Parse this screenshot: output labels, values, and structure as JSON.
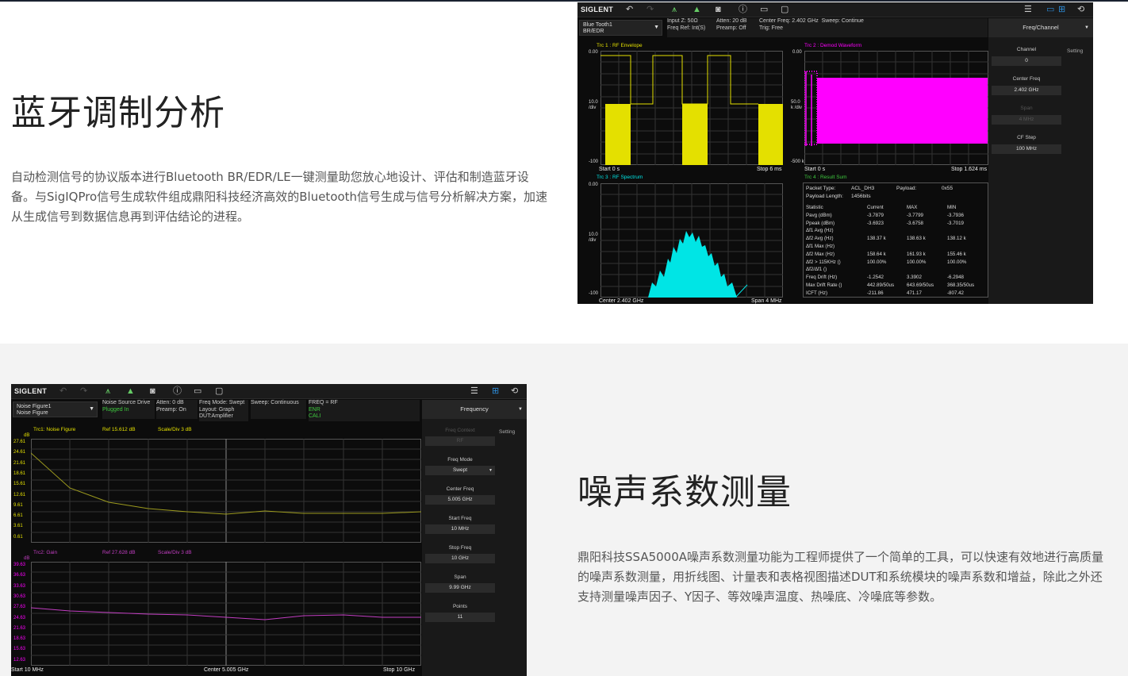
{
  "section1": {
    "title": "蓝牙调制分析",
    "description": "自动检测信号的协议版本进行Bluetooth BR/EDR/LE一键测量助您放心地设计、评估和制造蓝牙设备。与SigIQPro信号生成软件组成鼎阳科技经济高效的Bluetooth信号生成与信号分析解决方案，加速从生成信号到数据信息再到评估结论的进程。",
    "screenshot": {
      "brand": "SIGLENT",
      "mode_select": [
        "Blue Tooth1",
        "BR/EDR"
      ],
      "info": {
        "input_z": "Input Z: 50Ω",
        "freq_ref": "Freq Ref: Int(S)",
        "atten": "Atten: 20 dB",
        "preamp": "Preamp: Off",
        "center_freq": "Center Freq: 2.402 GHz",
        "sweep": "Sweep: Continue",
        "trig": "Trig: Free"
      },
      "panel": {
        "header": "Freq/Channel",
        "setting": "Setting",
        "items": [
          {
            "label": "Channel",
            "value": "0",
            "enabled": true
          },
          {
            "label": "Center Freq",
            "value": "2.402 GHz",
            "enabled": true
          },
          {
            "label": "Span",
            "value": "4 MHz",
            "enabled": false
          },
          {
            "label": "CF Step",
            "value": "100 MHz",
            "enabled": true
          }
        ]
      },
      "trace1": {
        "label": "Trc 1 :  RF Envelope",
        "ticks": [
          "0.00",
          "10.0 /div",
          "-100"
        ],
        "start": "Start 0 s",
        "stop": "Stop 6 ms"
      },
      "trace2": {
        "label": "Trc 2 :  Demod Waveform",
        "ticks": [
          "0.00",
          "50.0 k /div",
          "-500 k"
        ],
        "start": "Start 0 s",
        "stop": "Stop 1.624 ms"
      },
      "trace3": {
        "label": "Trc 3 :  RF Spectrum",
        "ticks": [
          "0.00",
          "10.0 /div",
          "-100"
        ],
        "start": "Center 2.402 GHz",
        "stop": "Span 4 MHz"
      },
      "trace4": {
        "label": "Trc 4 :  Result Sum",
        "packet_type_label": "Packet Type:",
        "packet_type": "ACL_DH3",
        "payload_label": "Payload:",
        "payload": "0x55",
        "payload_length_label": "Payload Length:",
        "payload_length": "1456bits",
        "columns": [
          "Statistic",
          "Current",
          "MAX",
          "MIN"
        ],
        "rows": [
          [
            "Pavg (dBm)",
            "-3.7879",
            "-3.7799",
            "-3.7936"
          ],
          [
            "Ppeak (dBm)",
            "-3.6923",
            "-3.6758",
            "-3.7019"
          ],
          [
            "Δf1 Avg (Hz)",
            "",
            "",
            ""
          ],
          [
            "Δf2 Avg (Hz)",
            "138.37 k",
            "138.63 k",
            "138.12 k"
          ],
          [
            "Δf1 Max (Hz)",
            "",
            "",
            ""
          ],
          [
            "Δf2 Max (Hz)",
            "158.64 k",
            "161.93 k",
            "155.46 k"
          ],
          [
            "Δf2 > 115KHz ()",
            "100.00%",
            "100.00%",
            "100.00%"
          ],
          [
            "Δf2/Δf1 ()",
            "",
            "",
            ""
          ],
          [
            "Freq Drift (Hz)",
            "-1.2542",
            "3.3902",
            "-6.2948"
          ],
          [
            "Max Drift Rate ()",
            "442.89/50us",
            "643.69/50us",
            "368.35/50us"
          ],
          [
            "ICFT (Hz)",
            "-211.86",
            "471.17",
            "-807.42"
          ]
        ]
      }
    }
  },
  "section2": {
    "title": "噪声系数测量",
    "description": "鼎阳科技SSA5000A噪声系数测量功能为工程师提供了一个简单的工具，可以快速有效地进行高质量的噪声系数测量，用折线图、计量表和表格视图描述DUT和系统模块的噪声系数和增益，除此之外还支持测量噪声因子、Y因子、等效噪声温度、热噪底、冷噪底等参数。",
    "screenshot": {
      "brand": "SIGLENT",
      "mode_select": [
        "Noise Figure1",
        "Noise Figure"
      ],
      "info": {
        "nsd": "Noise Source Drive",
        "plugged": "Plugged In",
        "atten": "Atten: 0 dB",
        "preamp": "Preamp: On",
        "freq_mode": "Freq Mode: Swept",
        "layout": "Layout: Graph",
        "dut": "DUT:Amplifier",
        "sweep": "Sweep: Continuous",
        "freq_rf": "FREQ = RF",
        "enr": "ENR",
        "cali": "CALI"
      },
      "panel": {
        "header": "Frequency",
        "setting": "Setting",
        "items": [
          {
            "label": "Freq Context",
            "value": "RF",
            "enabled": false
          },
          {
            "label": "Freq Mode",
            "value": "Swept",
            "enabled": true
          },
          {
            "label": "Center Freq",
            "value": "5.005 GHz",
            "enabled": true
          },
          {
            "label": "Start Freq",
            "value": "10 MHz",
            "enabled": true
          },
          {
            "label": "Stop Freq",
            "value": "10 GHz",
            "enabled": true
          },
          {
            "label": "Span",
            "value": "9.99 GHz",
            "enabled": true
          },
          {
            "label": "Points",
            "value": "11",
            "enabled": true
          }
        ]
      },
      "trace1": {
        "label": "Trc1:  Noise Figure",
        "ref": "Ref  15.612 dB",
        "scale": "Scale/Div  3 dB",
        "unit": "dB",
        "ticks": [
          "27.61",
          "24.61",
          "21.61",
          "18.61",
          "15.61",
          "12.61",
          "9.61",
          "6.61",
          "3.61",
          "0.61"
        ]
      },
      "trace2": {
        "label": "Trc2:  Gain",
        "ref": "Ref  27.628 dB",
        "scale": "Scale/Div  3 dB",
        "unit": "dB",
        "ticks": [
          "39.63",
          "36.63",
          "33.63",
          "30.63",
          "27.63",
          "24.63",
          "21.63",
          "18.63",
          "15.63",
          "12.63"
        ]
      },
      "x_start": "Start  10 MHz",
      "x_center": "Center  5.005 GHz",
      "x_stop": "Stop  10 GHz"
    }
  },
  "colors": {
    "trace_yellow": "#e4e000",
    "trace_magenta": "#ff00ff",
    "trace_cyan": "#00e5e5",
    "nf_line": "#9c9a1e",
    "gain_line": "#c23ec2",
    "accent_blue": "#2c8cd8"
  }
}
